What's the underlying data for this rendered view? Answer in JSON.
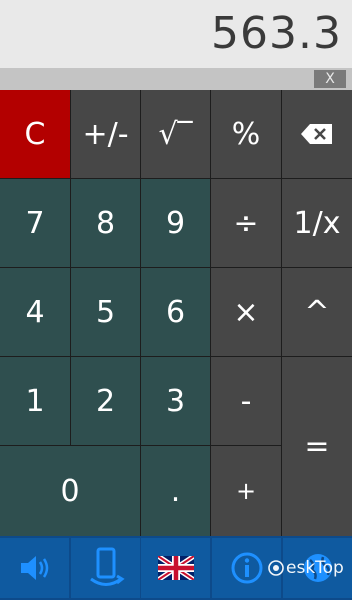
{
  "display": {
    "value": "563.3",
    "clear_label": "X"
  },
  "keys": {
    "clear": "C",
    "plus_minus": "+/-",
    "sqrt": "√‾",
    "percent": "%",
    "backspace": "⌫",
    "seven": "7",
    "eight": "8",
    "nine": "9",
    "divide": "÷",
    "reciprocal": "1/x",
    "four": "4",
    "five": "5",
    "six": "6",
    "multiply": "×",
    "power": "^",
    "one": "1",
    "two": "2",
    "three": "3",
    "minus": "-",
    "equals": "=",
    "zero": "0",
    "decimal": ".",
    "plus": "+"
  },
  "toolbar": {
    "icons": [
      "speaker-icon",
      "rotate-phone-icon",
      "uk-flag-icon",
      "info-icon",
      "globe-icon"
    ]
  },
  "watermark": {
    "text": "eskTop"
  },
  "colors": {
    "operator": "#474747",
    "number": "#2f4f4f",
    "clear": "#b30000",
    "toolbar": "#0f5aa0",
    "display_bg": "#e9e9e9"
  }
}
